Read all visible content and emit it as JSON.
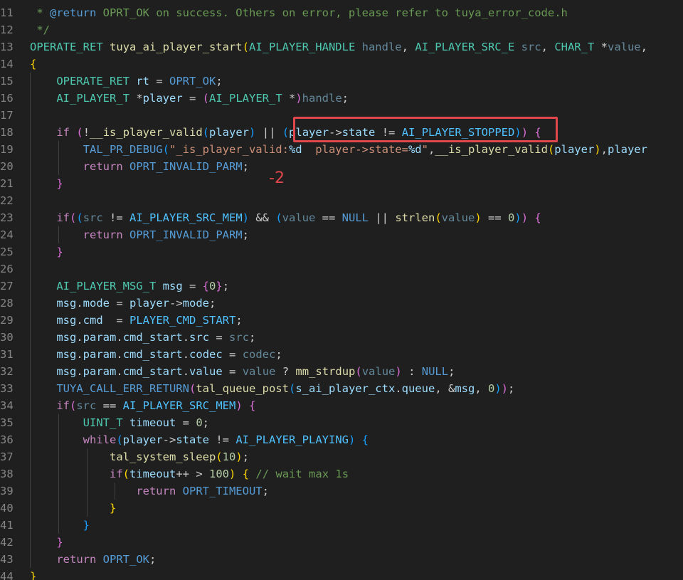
{
  "lines": [
    {
      "n": "11",
      "tokens": [
        [
          "t-cmt",
          " * "
        ],
        [
          "t-kw",
          "@return"
        ],
        [
          "t-cmt",
          " OPRT_OK on success. Others on error, please refer to tuya_error_code.h"
        ]
      ]
    },
    {
      "n": "12",
      "tokens": [
        [
          "t-cmt",
          " */"
        ]
      ]
    },
    {
      "n": "13",
      "tokens": [
        [
          "t-type",
          "OPERATE_RET"
        ],
        [
          "t-plain",
          " "
        ],
        [
          "t-fn",
          "tuya_ai_player_start"
        ],
        [
          "t-br1",
          "("
        ],
        [
          "t-type",
          "AI_PLAYER_HANDLE"
        ],
        [
          "t-plain",
          " "
        ],
        [
          "t-param",
          "handle"
        ],
        [
          "t-plain",
          ", "
        ],
        [
          "t-type",
          "AI_PLAYER_SRC_E"
        ],
        [
          "t-plain",
          " "
        ],
        [
          "t-param",
          "src"
        ],
        [
          "t-plain",
          ", "
        ],
        [
          "t-type",
          "CHAR_T"
        ],
        [
          "t-plain",
          " *"
        ],
        [
          "t-param",
          "value"
        ],
        [
          "t-plain",
          ","
        ]
      ]
    },
    {
      "n": "14",
      "tokens": [
        [
          "t-br1",
          "{"
        ]
      ]
    },
    {
      "n": "15",
      "tokens": [
        [
          "t-plain",
          "    "
        ],
        [
          "t-type",
          "OPERATE_RET"
        ],
        [
          "t-plain",
          " "
        ],
        [
          "t-var",
          "rt"
        ],
        [
          "t-plain",
          " = "
        ],
        [
          "t-macro",
          "OPRT_OK"
        ],
        [
          "t-plain",
          ";"
        ]
      ]
    },
    {
      "n": "16",
      "tokens": [
        [
          "t-plain",
          "    "
        ],
        [
          "t-type",
          "AI_PLAYER_T"
        ],
        [
          "t-plain",
          " *"
        ],
        [
          "t-var",
          "player"
        ],
        [
          "t-plain",
          " = "
        ],
        [
          "t-br2",
          "("
        ],
        [
          "t-type",
          "AI_PLAYER_T"
        ],
        [
          "t-plain",
          " *"
        ],
        [
          "t-br2",
          ")"
        ],
        [
          "t-param",
          "handle"
        ],
        [
          "t-plain",
          ";"
        ]
      ]
    },
    {
      "n": "17",
      "tokens": []
    },
    {
      "n": "18",
      "tokens": [
        [
          "t-plain",
          "    "
        ],
        [
          "t-kw2",
          "if"
        ],
        [
          "t-plain",
          " "
        ],
        [
          "t-br2",
          "("
        ],
        [
          "t-plain",
          "!"
        ],
        [
          "t-fn",
          "__is_player_valid"
        ],
        [
          "t-br3",
          "("
        ],
        [
          "t-var",
          "player"
        ],
        [
          "t-br3",
          ")"
        ],
        [
          "t-plain",
          " || "
        ],
        [
          "t-br3",
          "("
        ],
        [
          "t-var",
          "player"
        ],
        [
          "t-plain",
          "->"
        ],
        [
          "t-var",
          "state"
        ],
        [
          "t-plain",
          " != "
        ],
        [
          "t-const",
          "AI_PLAYER_STOPPED"
        ],
        [
          "t-br3",
          ")"
        ],
        [
          "t-br2",
          ")"
        ],
        [
          "t-plain",
          " "
        ],
        [
          "t-br2",
          "{"
        ]
      ]
    },
    {
      "n": "19",
      "tokens": [
        [
          "t-plain",
          "        "
        ],
        [
          "t-macro",
          "TAL_PR_DEBUG"
        ],
        [
          "t-br3",
          "("
        ],
        [
          "t-str",
          "\"_is_player_valid:"
        ],
        [
          "t-fmt",
          "%d"
        ],
        [
          "t-str",
          "  player->state="
        ],
        [
          "t-fmt",
          "%d"
        ],
        [
          "t-str",
          "\""
        ],
        [
          "t-plain",
          ","
        ],
        [
          "t-fn",
          "__is_player_valid"
        ],
        [
          "t-br1",
          "("
        ],
        [
          "t-var",
          "player"
        ],
        [
          "t-br1",
          ")"
        ],
        [
          "t-plain",
          ","
        ],
        [
          "t-var",
          "player"
        ]
      ]
    },
    {
      "n": "20",
      "tokens": [
        [
          "t-plain",
          "        "
        ],
        [
          "t-kw2",
          "return"
        ],
        [
          "t-plain",
          " "
        ],
        [
          "t-macro",
          "OPRT_INVALID_PARM"
        ],
        [
          "t-plain",
          ";"
        ]
      ]
    },
    {
      "n": "21",
      "tokens": [
        [
          "t-plain",
          "    "
        ],
        [
          "t-br2",
          "}"
        ]
      ]
    },
    {
      "n": "22",
      "tokens": []
    },
    {
      "n": "23",
      "tokens": [
        [
          "t-plain",
          "    "
        ],
        [
          "t-kw2",
          "if"
        ],
        [
          "t-br2",
          "("
        ],
        [
          "t-br3",
          "("
        ],
        [
          "t-param",
          "src"
        ],
        [
          "t-plain",
          " != "
        ],
        [
          "t-const",
          "AI_PLAYER_SRC_MEM"
        ],
        [
          "t-br3",
          ")"
        ],
        [
          "t-plain",
          " && "
        ],
        [
          "t-br3",
          "("
        ],
        [
          "t-param",
          "value"
        ],
        [
          "t-plain",
          " == "
        ],
        [
          "t-kw",
          "NULL"
        ],
        [
          "t-plain",
          " || "
        ],
        [
          "t-fn",
          "strlen"
        ],
        [
          "t-br1",
          "("
        ],
        [
          "t-param",
          "value"
        ],
        [
          "t-br1",
          ")"
        ],
        [
          "t-plain",
          " == "
        ],
        [
          "t-num",
          "0"
        ],
        [
          "t-br3",
          ")"
        ],
        [
          "t-br2",
          ")"
        ],
        [
          "t-plain",
          " "
        ],
        [
          "t-br2",
          "{"
        ]
      ]
    },
    {
      "n": "24",
      "tokens": [
        [
          "t-plain",
          "        "
        ],
        [
          "t-kw2",
          "return"
        ],
        [
          "t-plain",
          " "
        ],
        [
          "t-macro",
          "OPRT_INVALID_PARM"
        ],
        [
          "t-plain",
          ";"
        ]
      ]
    },
    {
      "n": "25",
      "tokens": [
        [
          "t-plain",
          "    "
        ],
        [
          "t-br2",
          "}"
        ]
      ]
    },
    {
      "n": "26",
      "tokens": []
    },
    {
      "n": "27",
      "tokens": [
        [
          "t-plain",
          "    "
        ],
        [
          "t-type",
          "AI_PLAYER_MSG_T"
        ],
        [
          "t-plain",
          " "
        ],
        [
          "t-var",
          "msg"
        ],
        [
          "t-plain",
          " = "
        ],
        [
          "t-br2",
          "{"
        ],
        [
          "t-num",
          "0"
        ],
        [
          "t-br2",
          "}"
        ],
        [
          "t-plain",
          ";"
        ]
      ]
    },
    {
      "n": "28",
      "tokens": [
        [
          "t-plain",
          "    "
        ],
        [
          "t-var",
          "msg"
        ],
        [
          "t-plain",
          "."
        ],
        [
          "t-var",
          "mode"
        ],
        [
          "t-plain",
          " = "
        ],
        [
          "t-var",
          "player"
        ],
        [
          "t-plain",
          "->"
        ],
        [
          "t-var",
          "mode"
        ],
        [
          "t-plain",
          ";"
        ]
      ]
    },
    {
      "n": "29",
      "tokens": [
        [
          "t-plain",
          "    "
        ],
        [
          "t-var",
          "msg"
        ],
        [
          "t-plain",
          "."
        ],
        [
          "t-var",
          "cmd"
        ],
        [
          "t-plain",
          "  = "
        ],
        [
          "t-const",
          "PLAYER_CMD_START"
        ],
        [
          "t-plain",
          ";"
        ]
      ]
    },
    {
      "n": "30",
      "tokens": [
        [
          "t-plain",
          "    "
        ],
        [
          "t-var",
          "msg"
        ],
        [
          "t-plain",
          "."
        ],
        [
          "t-var",
          "param"
        ],
        [
          "t-plain",
          "."
        ],
        [
          "t-var",
          "cmd_start"
        ],
        [
          "t-plain",
          "."
        ],
        [
          "t-var",
          "src"
        ],
        [
          "t-plain",
          " = "
        ],
        [
          "t-param",
          "src"
        ],
        [
          "t-plain",
          ";"
        ]
      ]
    },
    {
      "n": "31",
      "tokens": [
        [
          "t-plain",
          "    "
        ],
        [
          "t-var",
          "msg"
        ],
        [
          "t-plain",
          "."
        ],
        [
          "t-var",
          "param"
        ],
        [
          "t-plain",
          "."
        ],
        [
          "t-var",
          "cmd_start"
        ],
        [
          "t-plain",
          "."
        ],
        [
          "t-var",
          "codec"
        ],
        [
          "t-plain",
          " = "
        ],
        [
          "t-param",
          "codec"
        ],
        [
          "t-plain",
          ";"
        ]
      ]
    },
    {
      "n": "32",
      "tokens": [
        [
          "t-plain",
          "    "
        ],
        [
          "t-var",
          "msg"
        ],
        [
          "t-plain",
          "."
        ],
        [
          "t-var",
          "param"
        ],
        [
          "t-plain",
          "."
        ],
        [
          "t-var",
          "cmd_start"
        ],
        [
          "t-plain",
          "."
        ],
        [
          "t-var",
          "value"
        ],
        [
          "t-plain",
          " = "
        ],
        [
          "t-param",
          "value"
        ],
        [
          "t-plain",
          " ? "
        ],
        [
          "t-fn",
          "mm_strdup"
        ],
        [
          "t-br2",
          "("
        ],
        [
          "t-param",
          "value"
        ],
        [
          "t-br2",
          ")"
        ],
        [
          "t-plain",
          " : "
        ],
        [
          "t-kw",
          "NULL"
        ],
        [
          "t-plain",
          ";"
        ]
      ]
    },
    {
      "n": "33",
      "tokens": [
        [
          "t-plain",
          "    "
        ],
        [
          "t-macro",
          "TUYA_CALL_ERR_RETURN"
        ],
        [
          "t-br2",
          "("
        ],
        [
          "t-fn",
          "tal_queue_post"
        ],
        [
          "t-br3",
          "("
        ],
        [
          "t-var",
          "s_ai_player_ctx"
        ],
        [
          "t-plain",
          "."
        ],
        [
          "t-var",
          "queue"
        ],
        [
          "t-plain",
          ", &"
        ],
        [
          "t-var",
          "msg"
        ],
        [
          "t-plain",
          ", "
        ],
        [
          "t-num",
          "0"
        ],
        [
          "t-br3",
          ")"
        ],
        [
          "t-br2",
          ")"
        ],
        [
          "t-plain",
          ";"
        ]
      ]
    },
    {
      "n": "34",
      "tokens": [
        [
          "t-plain",
          "    "
        ],
        [
          "t-kw2",
          "if"
        ],
        [
          "t-br2",
          "("
        ],
        [
          "t-param",
          "src"
        ],
        [
          "t-plain",
          " == "
        ],
        [
          "t-const",
          "AI_PLAYER_SRC_MEM"
        ],
        [
          "t-br2",
          ")"
        ],
        [
          "t-plain",
          " "
        ],
        [
          "t-br2",
          "{"
        ]
      ]
    },
    {
      "n": "35",
      "tokens": [
        [
          "t-plain",
          "        "
        ],
        [
          "t-type",
          "UINT_T"
        ],
        [
          "t-plain",
          " "
        ],
        [
          "t-var",
          "timeout"
        ],
        [
          "t-plain",
          " = "
        ],
        [
          "t-num",
          "0"
        ],
        [
          "t-plain",
          ";"
        ]
      ]
    },
    {
      "n": "36",
      "tokens": [
        [
          "t-plain",
          "        "
        ],
        [
          "t-kw2",
          "while"
        ],
        [
          "t-br3",
          "("
        ],
        [
          "t-var",
          "player"
        ],
        [
          "t-plain",
          "->"
        ],
        [
          "t-var",
          "state"
        ],
        [
          "t-plain",
          " != "
        ],
        [
          "t-const",
          "AI_PLAYER_PLAYING"
        ],
        [
          "t-br3",
          ")"
        ],
        [
          "t-plain",
          " "
        ],
        [
          "t-br3",
          "{"
        ]
      ]
    },
    {
      "n": "37",
      "tokens": [
        [
          "t-plain",
          "            "
        ],
        [
          "t-fn",
          "tal_system_sleep"
        ],
        [
          "t-br1",
          "("
        ],
        [
          "t-num",
          "10"
        ],
        [
          "t-br1",
          ")"
        ],
        [
          "t-plain",
          ";"
        ]
      ]
    },
    {
      "n": "38",
      "tokens": [
        [
          "t-plain",
          "            "
        ],
        [
          "t-kw2",
          "if"
        ],
        [
          "t-br1",
          "("
        ],
        [
          "t-var",
          "timeout"
        ],
        [
          "t-plain",
          "++ > "
        ],
        [
          "t-num",
          "100"
        ],
        [
          "t-br1",
          ")"
        ],
        [
          "t-plain",
          " "
        ],
        [
          "t-br1",
          "{"
        ],
        [
          "t-plain",
          " "
        ],
        [
          "t-cmt",
          "// wait max 1s"
        ]
      ]
    },
    {
      "n": "39",
      "tokens": [
        [
          "t-plain",
          "                "
        ],
        [
          "t-kw2",
          "return"
        ],
        [
          "t-plain",
          " "
        ],
        [
          "t-macro",
          "OPRT_TIMEOUT"
        ],
        [
          "t-plain",
          ";"
        ]
      ]
    },
    {
      "n": "40",
      "tokens": [
        [
          "t-plain",
          "            "
        ],
        [
          "t-br1",
          "}"
        ]
      ]
    },
    {
      "n": "41",
      "tokens": [
        [
          "t-plain",
          "        "
        ],
        [
          "t-br3",
          "}"
        ]
      ]
    },
    {
      "n": "42",
      "tokens": [
        [
          "t-plain",
          "    "
        ],
        [
          "t-br2",
          "}"
        ]
      ]
    },
    {
      "n": "43",
      "tokens": [
        [
          "t-plain",
          "    "
        ],
        [
          "t-kw2",
          "return"
        ],
        [
          "t-plain",
          " "
        ],
        [
          "t-macro",
          "OPRT_OK"
        ],
        [
          "t-plain",
          ";"
        ]
      ]
    },
    {
      "n": "44",
      "tokens": [
        [
          "t-br1",
          "}"
        ]
      ]
    }
  ],
  "annotation": {
    "label": "-2",
    "color": "#e0474c"
  }
}
